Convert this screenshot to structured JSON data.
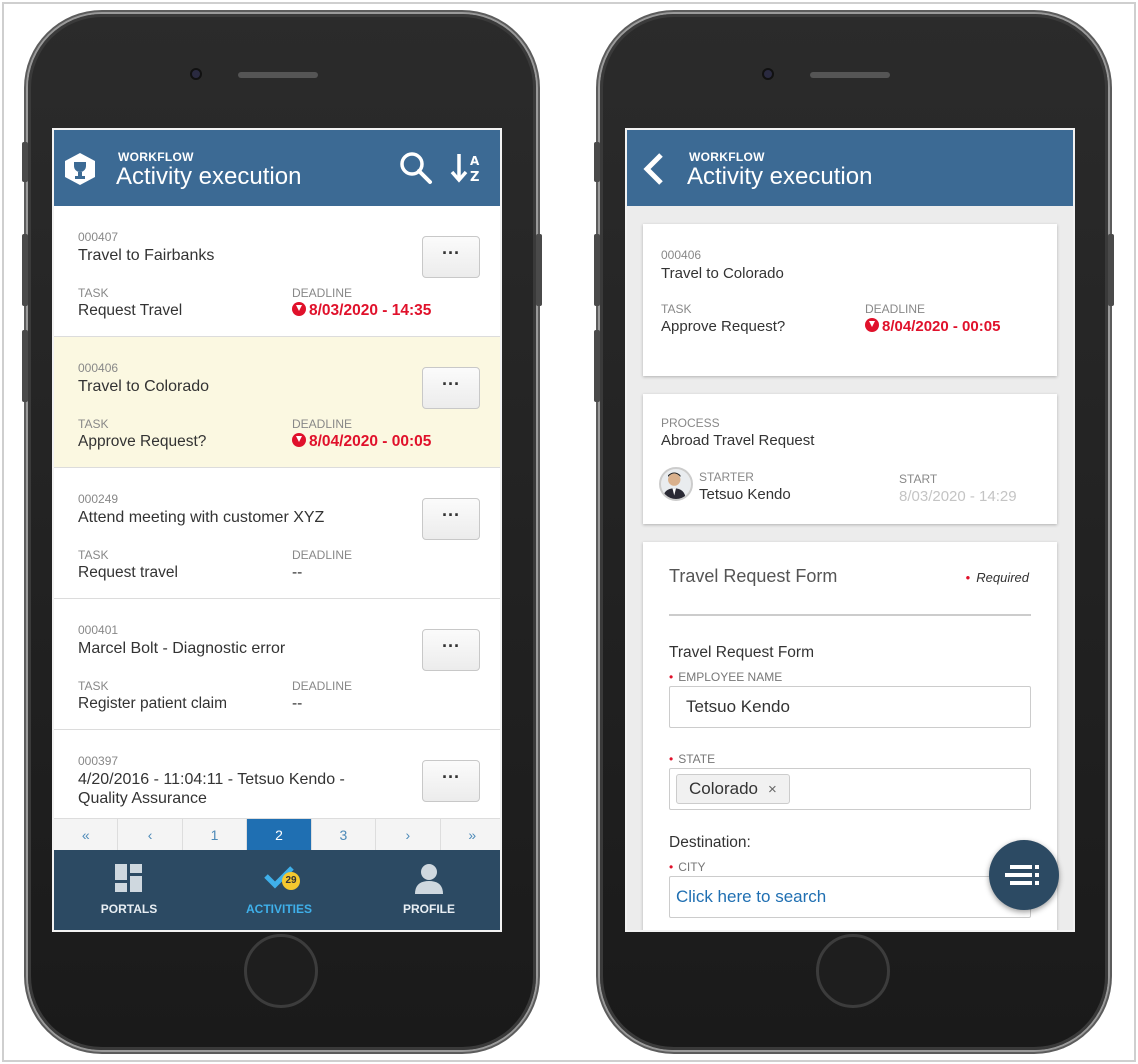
{
  "left_screen": {
    "header": {
      "small": "WORKFLOW",
      "title": "Activity execution"
    },
    "items": [
      {
        "code": "000407",
        "title": "Travel to Fairbanks",
        "task_label": "TASK",
        "task": "Request Travel",
        "deadline_label": "DEADLINE",
        "deadline": "8/03/2020 - 14:35",
        "overdue": true,
        "menu": "···"
      },
      {
        "code": "000406",
        "title": "Travel to Colorado",
        "task_label": "TASK",
        "task": "Approve Request?",
        "deadline_label": "DEADLINE",
        "deadline": "8/04/2020 - 00:05",
        "overdue": true,
        "menu": "···"
      },
      {
        "code": "000249",
        "title": "Attend meeting with customer XYZ",
        "task_label": "TASK",
        "task": "Request travel",
        "deadline_label": "DEADLINE",
        "deadline": "--",
        "overdue": false,
        "menu": "···"
      },
      {
        "code": "000401",
        "title": "Marcel Bolt - Diagnostic error",
        "task_label": "TASK",
        "task": "Register patient claim",
        "deadline_label": "DEADLINE",
        "deadline": "--",
        "overdue": false,
        "menu": "···"
      },
      {
        "code": "000397",
        "title": "4/20/2016 - 11:04:11 - Tetsuo Kendo - Quality Assurance",
        "menu": "···"
      }
    ],
    "pager": [
      "«",
      "‹",
      "1",
      "2",
      "3",
      "›",
      "»"
    ],
    "tabs": [
      {
        "label": "PORTALS"
      },
      {
        "label": "ACTIVITIES",
        "badge": "29"
      },
      {
        "label": "PROFILE"
      }
    ]
  },
  "right_screen": {
    "header": {
      "small": "WORKFLOW",
      "title": "Activity execution"
    },
    "activity": {
      "code": "000406",
      "title": "Travel to Colorado",
      "task_label": "TASK",
      "task": "Approve Request?",
      "deadline_label": "DEADLINE",
      "deadline": "8/04/2020 - 00:05"
    },
    "process": {
      "label": "PROCESS",
      "name": "Abroad Travel Request",
      "starter_label": "STARTER",
      "starter": "Tetsuo Kendo",
      "start_label": "START",
      "start": "8/03/2020 - 14:29"
    },
    "form": {
      "title": "Travel Request Form",
      "required": "Required",
      "section": "Travel Request Form",
      "employee_label": "EMPLOYEE NAME",
      "employee_value": "Tetsuo Kendo",
      "state_label": "STATE",
      "state_value": "Colorado",
      "state_remove": "×",
      "destination": "Destination:",
      "city_label": "CITY",
      "city_placeholder": "Click here to search"
    }
  },
  "colors": {
    "header": "#3c6a94",
    "deadline": "#e0112b",
    "selected_row": "#fbf8e1",
    "tabbar": "#2c4a63",
    "active_tab": "#3fb0ea",
    "pager_active": "#1f6fb2",
    "link": "#1f6fb2"
  }
}
